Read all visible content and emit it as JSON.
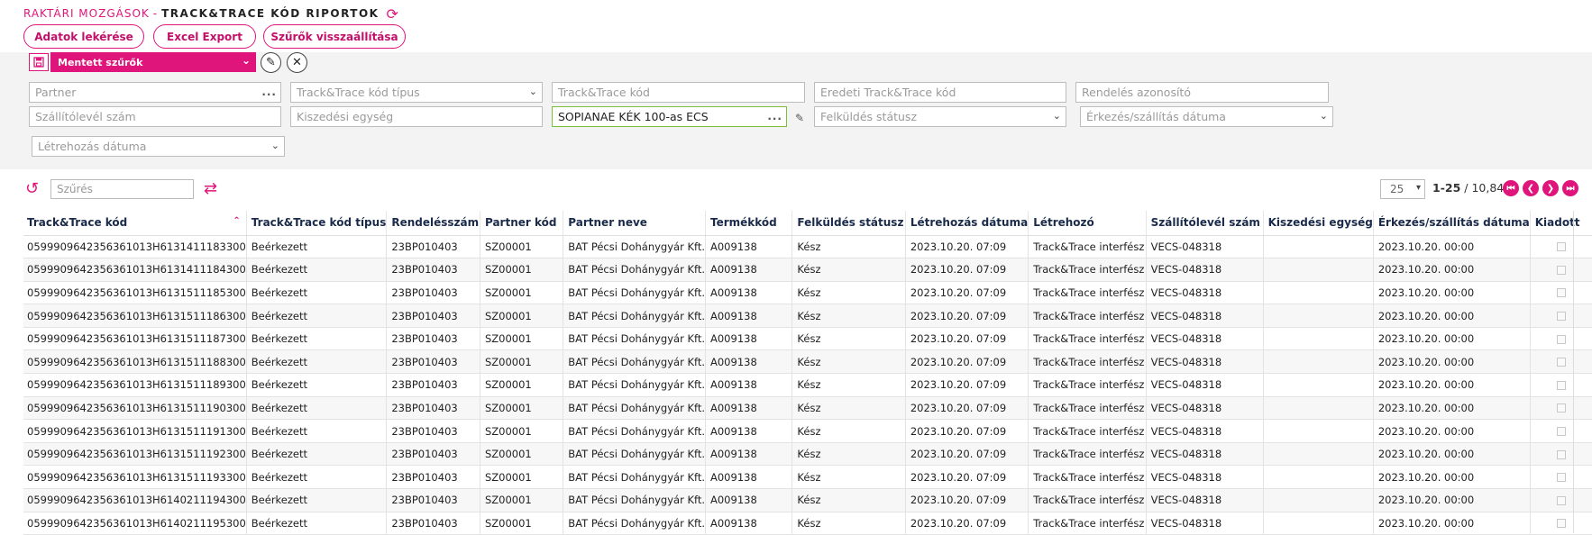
{
  "breadcrumb": {
    "parent": "RAKTÁRI MOZGÁSOK",
    "separator": "-",
    "current": "TRACK&TRACE KÓD RIPORTOK"
  },
  "toolbar": {
    "fetch": "Adatok lekérése",
    "excel": "Excel Export",
    "reset_filters": "Szűrők visszaállítása"
  },
  "saved_filters": {
    "label": "Mentett szűrők"
  },
  "filters": {
    "partner": "Partner",
    "tt_type": "Track&Trace kód típus",
    "tt_code": "Track&Trace kód",
    "orig_tt_code": "Eredeti Track&Trace kód",
    "order_id": "Rendelés azonosító",
    "delivery_note": "Szállítólevél szám",
    "unit": "Kiszedési egység",
    "product_value": "SOPIANAE KÉK 100-as ECS",
    "send_status": "Felküldés státusz",
    "arrival_date": "Érkezés/szállítás dátuma",
    "created_date": "Létrehozás dátuma"
  },
  "search": {
    "placeholder": "Szűrés"
  },
  "pagination": {
    "page_size": "25",
    "range": "1-25",
    "total": " / 10,844"
  },
  "columns": [
    "Track&Trace kód",
    "Track&Trace kód típus",
    "Rendelésszám",
    "Partner kód",
    "Partner neve",
    "Termékkód",
    "Felküldés státusz",
    "Létrehozás dátuma",
    "Létrehozó",
    "Szállítólevél szám",
    "Kiszedési egység",
    "Érkezés/szállítás dátuma",
    "Kiadott"
  ],
  "rows": [
    [
      "0599909642356361013H6131411183300",
      "Beérkezett",
      "23BP010403",
      "SZ00001",
      "BAT Pécsi Dohánygyár Kft.",
      "A009138",
      "Kész",
      "2023.10.20. 07:09",
      "Track&Trace interfész",
      "VECS-048318",
      "",
      "2023.10.20. 00:00"
    ],
    [
      "0599909642356361013H6131411184300",
      "Beérkezett",
      "23BP010403",
      "SZ00001",
      "BAT Pécsi Dohánygyár Kft.",
      "A009138",
      "Kész",
      "2023.10.20. 07:09",
      "Track&Trace interfész",
      "VECS-048318",
      "",
      "2023.10.20. 00:00"
    ],
    [
      "0599909642356361013H6131511185300",
      "Beérkezett",
      "23BP010403",
      "SZ00001",
      "BAT Pécsi Dohánygyár Kft.",
      "A009138",
      "Kész",
      "2023.10.20. 07:09",
      "Track&Trace interfész",
      "VECS-048318",
      "",
      "2023.10.20. 00:00"
    ],
    [
      "0599909642356361013H6131511186300",
      "Beérkezett",
      "23BP010403",
      "SZ00001",
      "BAT Pécsi Dohánygyár Kft.",
      "A009138",
      "Kész",
      "2023.10.20. 07:09",
      "Track&Trace interfész",
      "VECS-048318",
      "",
      "2023.10.20. 00:00"
    ],
    [
      "0599909642356361013H6131511187300",
      "Beérkezett",
      "23BP010403",
      "SZ00001",
      "BAT Pécsi Dohánygyár Kft.",
      "A009138",
      "Kész",
      "2023.10.20. 07:09",
      "Track&Trace interfész",
      "VECS-048318",
      "",
      "2023.10.20. 00:00"
    ],
    [
      "0599909642356361013H6131511188300",
      "Beérkezett",
      "23BP010403",
      "SZ00001",
      "BAT Pécsi Dohánygyár Kft.",
      "A009138",
      "Kész",
      "2023.10.20. 07:09",
      "Track&Trace interfész",
      "VECS-048318",
      "",
      "2023.10.20. 00:00"
    ],
    [
      "0599909642356361013H6131511189300",
      "Beérkezett",
      "23BP010403",
      "SZ00001",
      "BAT Pécsi Dohánygyár Kft.",
      "A009138",
      "Kész",
      "2023.10.20. 07:09",
      "Track&Trace interfész",
      "VECS-048318",
      "",
      "2023.10.20. 00:00"
    ],
    [
      "0599909642356361013H6131511190300",
      "Beérkezett",
      "23BP010403",
      "SZ00001",
      "BAT Pécsi Dohánygyár Kft.",
      "A009138",
      "Kész",
      "2023.10.20. 07:09",
      "Track&Trace interfész",
      "VECS-048318",
      "",
      "2023.10.20. 00:00"
    ],
    [
      "0599909642356361013H6131511191300",
      "Beérkezett",
      "23BP010403",
      "SZ00001",
      "BAT Pécsi Dohánygyár Kft.",
      "A009138",
      "Kész",
      "2023.10.20. 07:09",
      "Track&Trace interfész",
      "VECS-048318",
      "",
      "2023.10.20. 00:00"
    ],
    [
      "0599909642356361013H6131511192300",
      "Beérkezett",
      "23BP010403",
      "SZ00001",
      "BAT Pécsi Dohánygyár Kft.",
      "A009138",
      "Kész",
      "2023.10.20. 07:09",
      "Track&Trace interfész",
      "VECS-048318",
      "",
      "2023.10.20. 00:00"
    ],
    [
      "0599909642356361013H6131511193300",
      "Beérkezett",
      "23BP010403",
      "SZ00001",
      "BAT Pécsi Dohánygyár Kft.",
      "A009138",
      "Kész",
      "2023.10.20. 07:09",
      "Track&Trace interfész",
      "VECS-048318",
      "",
      "2023.10.20. 00:00"
    ],
    [
      "0599909642356361013H6140211194300",
      "Beérkezett",
      "23BP010403",
      "SZ00001",
      "BAT Pécsi Dohánygyár Kft.",
      "A009138",
      "Kész",
      "2023.10.20. 07:09",
      "Track&Trace interfész",
      "VECS-048318",
      "",
      "2023.10.20. 00:00"
    ],
    [
      "0599909642356361013H6140211195300",
      "Beérkezett",
      "23BP010403",
      "SZ00001",
      "BAT Pécsi Dohánygyár Kft.",
      "A009138",
      "Kész",
      "2023.10.20. 07:09",
      "Track&Trace interfész",
      "VECS-048318",
      "",
      "2023.10.20. 00:00"
    ]
  ],
  "colors": {
    "accent": "#e0157b",
    "header_text": "#1a2a4a",
    "valid_border": "#7bbf3a"
  }
}
